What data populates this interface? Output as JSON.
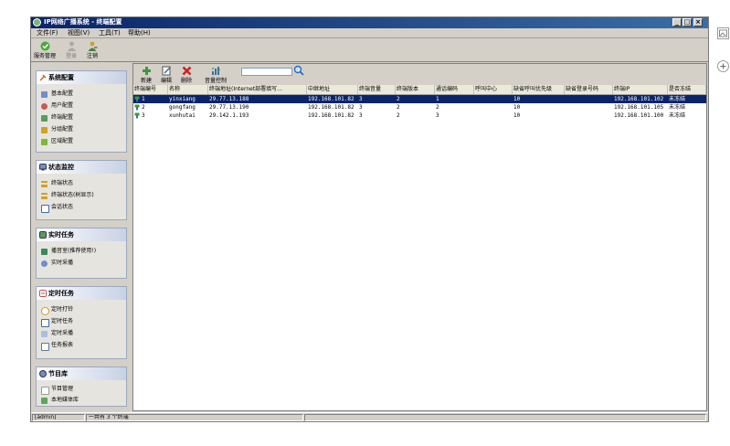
{
  "window": {
    "title": "IP网络广播系统  -  终端配置",
    "controls": [
      "_",
      "□",
      "×"
    ]
  },
  "menu": [
    "文件(F)",
    "视图(V)",
    "工具(T)",
    "帮助(H)"
  ],
  "toolbar": {
    "buttons": [
      {
        "label": "服务管理",
        "icon": "check-shield-icon"
      },
      {
        "label": "登录",
        "icon": "user-login-icon"
      },
      {
        "label": "注销",
        "icon": "user-logout-icon"
      }
    ]
  },
  "sidebar": {
    "panels": [
      {
        "title": "系统配置",
        "items": [
          "基本配置",
          "用户配置",
          "终端配置",
          "分组配置",
          "区域配置"
        ]
      },
      {
        "title": "状态监控",
        "items": [
          "终端状态",
          "终端状态(树显示)",
          "会话状态"
        ]
      },
      {
        "title": "实时任务",
        "items": [
          "播音室(推荐使用!)",
          "实时采播"
        ]
      },
      {
        "title": "定时任务",
        "items": [
          "定时打铃",
          "定时任务",
          "定时采播",
          "任务报表"
        ]
      },
      {
        "title": "节目库",
        "items": [
          "节目管理",
          "本地媒体库"
        ]
      }
    ]
  },
  "main_toolbar": {
    "buttons": [
      "新建",
      "编辑",
      "删除",
      "音量控制"
    ],
    "search_value": ""
  },
  "table": {
    "columns": [
      "终端编号",
      "名称",
      "终端地址(Internet部署填写...",
      "中继地址",
      "终端音量",
      "终端版本",
      "通话编码",
      "呼叫中心",
      "缺省呼叫优先级",
      "缺省登录号码",
      "终端IP",
      "是否冻结"
    ],
    "rows": [
      [
        "1",
        "yinxiang",
        "29.77.13.188",
        "192.168.101.82",
        "3",
        "2",
        "1",
        "",
        "10",
        "",
        "192.168.101.102",
        "未冻结"
      ],
      [
        "2",
        "gongfang",
        "29.77.13.190",
        "192.168.101.82",
        "3",
        "2",
        "2",
        "",
        "10",
        "",
        "192.168.101.105",
        "未冻结"
      ],
      [
        "3",
        "xunhutai",
        "29.142.1.193",
        "192.168.101.82",
        "3",
        "2",
        "3",
        "",
        "10",
        "",
        "192.168.101.100",
        "未冻结"
      ]
    ],
    "selected_row": 0
  },
  "statusbar": {
    "user": "[admin]",
    "count": "一共有 3 个终端",
    "blank": ""
  },
  "colors": {
    "title_bar": "#0a246a",
    "selection": "#0a246a",
    "panel_border": "#9aa8c0"
  }
}
